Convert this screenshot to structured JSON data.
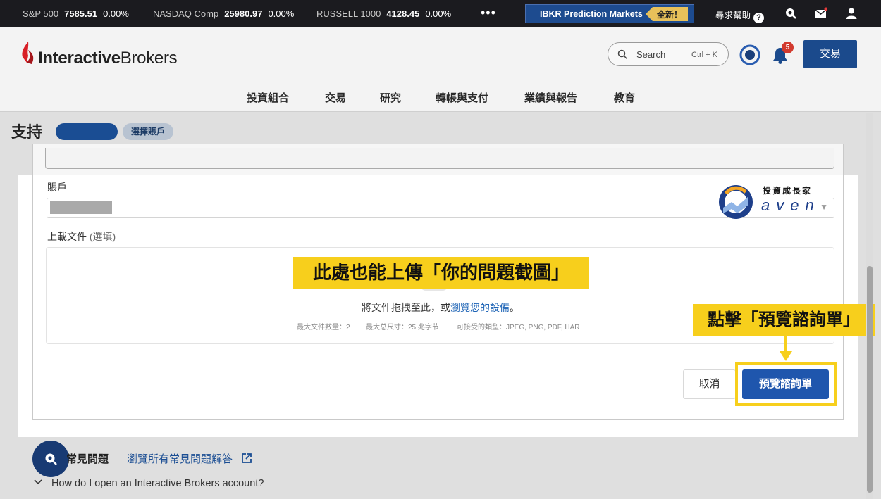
{
  "ticker": [
    {
      "name": "S&P 500",
      "value": "7585.51",
      "change": "0.00%"
    },
    {
      "name": "NASDAQ Comp",
      "value": "25980.97",
      "change": "0.00%"
    },
    {
      "name": "RUSSELL 1000",
      "value": "4128.45",
      "change": "0.00%"
    }
  ],
  "topbar": {
    "more": "•••",
    "promo_label": "IBKR Prediction Markets",
    "promo_badge": "全新！",
    "help_label": "尋求幫助"
  },
  "header": {
    "logo_bold": "Interactive",
    "logo_rest": "Brokers",
    "search_label": "Search",
    "search_shortcut": "Ctrl + K",
    "bell_count": "5",
    "trade_button": "交易"
  },
  "nav": [
    "投資組合",
    "交易",
    "研究",
    "轉帳與支付",
    "業績與報告",
    "教育"
  ],
  "page": {
    "title": "支持",
    "account_select": "選擇賬戶"
  },
  "form": {
    "account_label": "賬戶",
    "upload_label": "上載文件",
    "upload_optional": "(選填)",
    "drop_text_before": "將文件拖拽至此，或",
    "drop_link": "瀏覽您的設備",
    "drop_text_after": "。",
    "meta_count": "最大文件數量：2",
    "meta_size": "最大总尺寸：25 兆字节",
    "meta_types": "可接受的類型：JPEG, PNG, PDF, HAR",
    "cancel_button": "取消",
    "preview_button": "預覽諮詢單"
  },
  "callouts": {
    "upload_tip": "此處也能上傳「你的問題截圖」",
    "preview_tip": "點擊「預覽諮詢單」"
  },
  "watermark": {
    "title": "投資成長家",
    "brand": "aven"
  },
  "faq": {
    "title": "常見問題",
    "browse_link": "瀏覽所有常見問題解答",
    "question_1": "How do I open an Interactive Brokers account?"
  },
  "colors": {
    "brand_blue": "#1b4a8c",
    "primary_button": "#1f56ad",
    "callout_yellow": "#f7cf1c",
    "ticker_bg": "#1b1b1f",
    "logo_red": "#d81f26"
  }
}
